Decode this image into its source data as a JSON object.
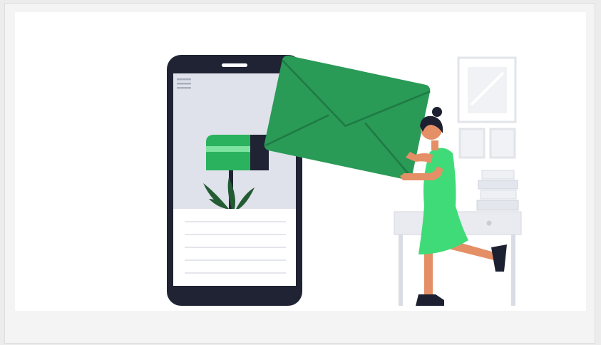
{
  "illustration": {
    "subject": "",
    "colors": {
      "frame_background": "#f4f4f5",
      "card_background": "#ffffff",
      "phone_body": "#1f2333",
      "phone_screen_top": "#dfe2ea",
      "envelope_green": "#2a9a57",
      "envelope_dark": "#1e7a44",
      "mailbox_green": "#2bb25e",
      "dress_green": "#3fdb78",
      "skin": "#e58f67",
      "hair": "#1c2031",
      "furniture": "#e6e8ee"
    },
    "icons": [
      "menu-icon",
      "envelope-icon",
      "mailbox-icon",
      "plant-icon",
      "picture-frame-icon"
    ]
  }
}
